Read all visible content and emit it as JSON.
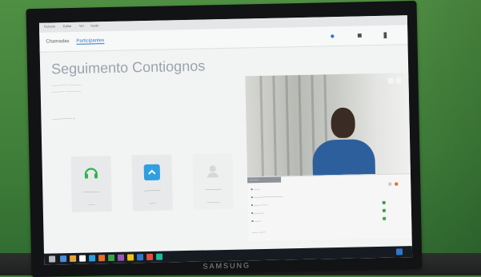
{
  "app": {
    "menu": [
      "Ficheiro",
      "Editar",
      "Ver",
      "Ajuda"
    ],
    "tabs": [
      {
        "label": "Chamadas",
        "active": false
      },
      {
        "label": "Participantes",
        "active": true
      }
    ],
    "toolbar": [
      {
        "icon": "users-icon",
        "active": true
      },
      {
        "icon": "chat-icon",
        "active": false
      },
      {
        "icon": "settings-icon",
        "active": false
      }
    ]
  },
  "main": {
    "title": "Seguimento Contiognos",
    "cards": [
      {
        "icon": "headset-icon",
        "accent": "#2fb34a"
      },
      {
        "icon": "chevron-up-icon",
        "accent": "#2f9fe0"
      },
      {
        "icon": "person-placeholder-icon",
        "accent": "#d6d7d8"
      }
    ]
  },
  "monitor": {
    "brand": "SAMSUNG"
  },
  "colors": {
    "wall": "#3f7f3a",
    "shirt": "#2e5f9d",
    "accent_orange": "#e8702a",
    "status_green": "#3aa34a"
  }
}
